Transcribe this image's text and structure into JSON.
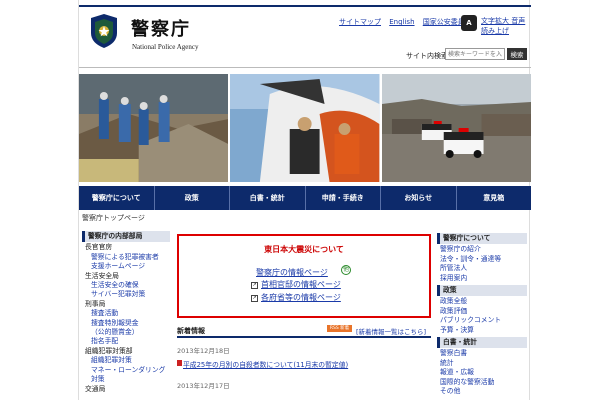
{
  "header": {
    "title": "警察庁",
    "subtitle": "National Police Agency",
    "links": [
      "サイトマップ",
      "English",
      "国家公安委員会"
    ],
    "accessibility_icon": "A",
    "accessibility": "文字拡大 音声読み上げ",
    "search_label": "サイト内検索",
    "search_placeholder": "検索キーワードを入力",
    "search_button": "検索"
  },
  "nav": [
    "警察庁について",
    "政策",
    "白書・統計",
    "申請・手続き",
    "お知らせ",
    "意見箱"
  ],
  "breadcrumb": "警察庁トップページ",
  "left": {
    "heading": "警察庁の内部部局",
    "items": [
      {
        "text": "長官官房",
        "level": 1
      },
      {
        "text": "警察による犯罪被害者",
        "level": 2
      },
      {
        "text": "支援ホームページ",
        "level": 2
      },
      {
        "text": "生活安全局",
        "level": 1
      },
      {
        "text": "生活安全の確保",
        "level": 2
      },
      {
        "text": "サイバー犯罪対策",
        "level": 2
      },
      {
        "text": "刑事局",
        "level": 1
      },
      {
        "text": "捜査活動",
        "level": 2
      },
      {
        "text": "捜査特別報奨金",
        "level": 2
      },
      {
        "text": "（公的懸賞金）",
        "level": 2
      },
      {
        "text": "指名手配",
        "level": 2
      },
      {
        "text": "組織犯罪対策部",
        "level": 1
      },
      {
        "text": "組織犯罪対策",
        "level": 2
      },
      {
        "text": "マネー・ローンダリング対策",
        "level": 2
      },
      {
        "text": "交通局",
        "level": 1
      }
    ]
  },
  "right": {
    "sections": [
      {
        "heading": "警察庁について",
        "items": [
          "警察庁の紹介",
          "法令・訓令・通達等",
          "所管法人",
          "採用案内"
        ]
      },
      {
        "heading": "政策",
        "items": [
          "政策全般",
          "政策評価",
          "パブリックコメント",
          "予算・決算"
        ]
      },
      {
        "heading": "白書・統計",
        "items": [
          "警察白書",
          "統計",
          "報道・広報",
          "国際的な警察活動",
          "その他"
        ]
      }
    ]
  },
  "quake": {
    "title": "東日本大震災について",
    "links": [
      "警察庁の情報ページ",
      "首相官邸の情報ページ",
      "各府省等の情報ページ"
    ],
    "badge": "他"
  },
  "news": {
    "title": "新着情報",
    "rss": "RSS 新着",
    "more": "[新着情報一覧はこちら]",
    "items": [
      {
        "date": "2013年12月18日",
        "title": "平成25年の月別の自殺者数について(11月末の暫定値)"
      },
      {
        "date": "2013年12月17日",
        "title": ""
      }
    ]
  }
}
